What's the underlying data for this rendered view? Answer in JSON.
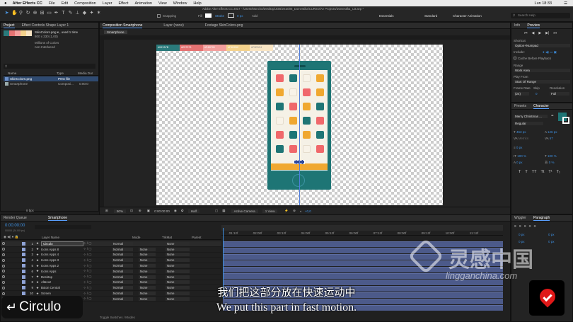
{
  "menubar": {
    "app": "After Effects CC",
    "items": [
      "File",
      "Edit",
      "Composition",
      "Layer",
      "Effect",
      "Animation",
      "View",
      "Window",
      "Help"
    ],
    "clock": "Lun 18:33"
  },
  "title": "Adobe After Effects CC 2017 - /Users/Moncho/Desktop/JOB/2018/06_Domestika/CURSO/Ae Projects/Domestika_U3.aep *",
  "toolbar": {
    "snapping": "Snapping",
    "fill": "Fill",
    "stroke": "Stroke",
    "stroke_px": "0 px",
    "add": "Add",
    "workspaces": [
      "Essentials",
      "Standard",
      "Character Animation"
    ],
    "search_placeholder": "Search Help"
  },
  "project": {
    "tabs": [
      "Project",
      "Effect Controls Shape Layer 1"
    ],
    "item_name": "SkinColors.png",
    "item_used": ", used 1 time",
    "item_size": "800 x 330 (1,00)",
    "item_colors": "Millions of Colors",
    "item_interlace": "non-Interlaced",
    "search_placeholder": "",
    "cols": {
      "name": "Name",
      "type": "Type",
      "media": "Media Dur"
    },
    "items": [
      {
        "name": "SkinColors.png",
        "type": "PNG file",
        "dur": ""
      },
      {
        "name": "Smartphone",
        "type": "Composi...",
        "dur": "0:00:0"
      }
    ],
    "bpc": "8 bpc"
  },
  "comp": {
    "tabs": [
      "Composition Smartphone",
      "Layer (none)",
      "Footage SkinColors.png"
    ],
    "sub_tab": "Smartphone",
    "zoom": "50%",
    "time": "0:00:00:00",
    "res": "Half",
    "camera": "Active Camera",
    "view": "1 View",
    "exposure": "+0,0",
    "palette_labels": [
      "#2A7A7B",
      "#E57373",
      "#F49F9D",
      "#F4D28C",
      "#F9E5C4"
    ]
  },
  "info_panel": {
    "tabs": [
      "Info",
      "Preview"
    ],
    "shortcut_label": "Shortcut",
    "shortcut": "Option+Numpad",
    "include_label": "Include:",
    "cache": "Cache Before Playback",
    "range_label": "Range",
    "range": "Work Area",
    "play_from_label": "Play From",
    "play_from": "Start Of Range",
    "frame_rate_label": "Frame Rate",
    "skip_label": "Skip",
    "resolution_label": "Resolution",
    "frame_rate": "(24)",
    "skip": "0",
    "resolution": "Full"
  },
  "character": {
    "tabs": [
      "Presets",
      "Character"
    ],
    "font": "Merry Christmas ...",
    "style": "Regular",
    "size": "453 px",
    "leading": "126 px",
    "metrics": "Metrics",
    "tracking": "57",
    "scale_v": "100 %",
    "scale_h": "100 %",
    "baseline": "0 px",
    "tsume": "0 %"
  },
  "timeline": {
    "tabs": [
      "Render Queue",
      "Smartphone"
    ],
    "time": "0:00:00:00",
    "fps": "00000 (24.00 fps)",
    "headers": {
      "src": "Layer Name",
      "mode": "Mode",
      "trkmat": "TrkMat",
      "parent": "Parent"
    },
    "ruler": [
      "01:12f",
      "02:00f",
      "03:12f",
      "04:00f",
      "05:12f",
      "06:00f",
      "07:12f",
      "08:00f",
      "09:12f",
      "10:00f",
      "11:12f"
    ],
    "layers": [
      {
        "num": "1",
        "name": "Circulo",
        "mode": "Normal",
        "trk": "",
        "parent": "None",
        "color": "#8fa3d6"
      },
      {
        "num": "2",
        "name": "Icons Apps 8",
        "mode": "Normal",
        "trk": "None",
        "parent": "None",
        "color": "#8fa3d6"
      },
      {
        "num": "3",
        "name": "Icons Apps 4",
        "mode": "Normal",
        "trk": "None",
        "parent": "None",
        "color": "#8fa3d6"
      },
      {
        "num": "4",
        "name": "Icons Apps 3",
        "mode": "Normal",
        "trk": "None",
        "parent": "None",
        "color": "#8fa3d6"
      },
      {
        "num": "5",
        "name": "Icons Apps 2",
        "mode": "Normal",
        "trk": "None",
        "parent": "None",
        "color": "#8fa3d6"
      },
      {
        "num": "6",
        "name": "Icons Apps",
        "mode": "Normal",
        "trk": "None",
        "parent": "None",
        "color": "#8fa3d6"
      },
      {
        "num": "7",
        "name": "Desktop",
        "mode": "Normal",
        "trk": "None",
        "parent": "None",
        "color": "#8fa3d6"
      },
      {
        "num": "8",
        "name": "Altavoz",
        "mode": "Normal",
        "trk": "None",
        "parent": "None",
        "color": "#8fa3d6"
      },
      {
        "num": "9",
        "name": "Boton Central",
        "mode": "Normal",
        "trk": "None",
        "parent": "None",
        "color": "#8fa3d6"
      },
      {
        "num": "10",
        "name": "Screen",
        "mode": "Normal",
        "trk": "None",
        "parent": "None",
        "color": "#8fa3d6"
      },
      {
        "num": "11",
        "name": "Base iPhone",
        "mode": "Normal",
        "trk": "None",
        "parent": "None",
        "color": "#8fa3d6"
      }
    ],
    "toggle": "Toggle Switches / Modes"
  },
  "wiggler": {
    "tabs": [
      "Wiggler",
      "Paragraph"
    ],
    "indent_vals": [
      "0 px",
      "0 px",
      "0 px",
      "0 px"
    ]
  },
  "overlay": {
    "back_label": "Circulo",
    "subtitle_cn": "我们把这部分放在快速运动中",
    "subtitle_en": "We put this part in fast motion.",
    "watermark_cn": "灵感中国",
    "watermark_url": "lingganchina.com"
  },
  "colors": {
    "teal": "#1e7575",
    "coral": "#f0686b",
    "mustard": "#f0a830",
    "cream": "#f8f3e8",
    "screen": "#f5f1e6",
    "accent": "#3d8fe0"
  }
}
